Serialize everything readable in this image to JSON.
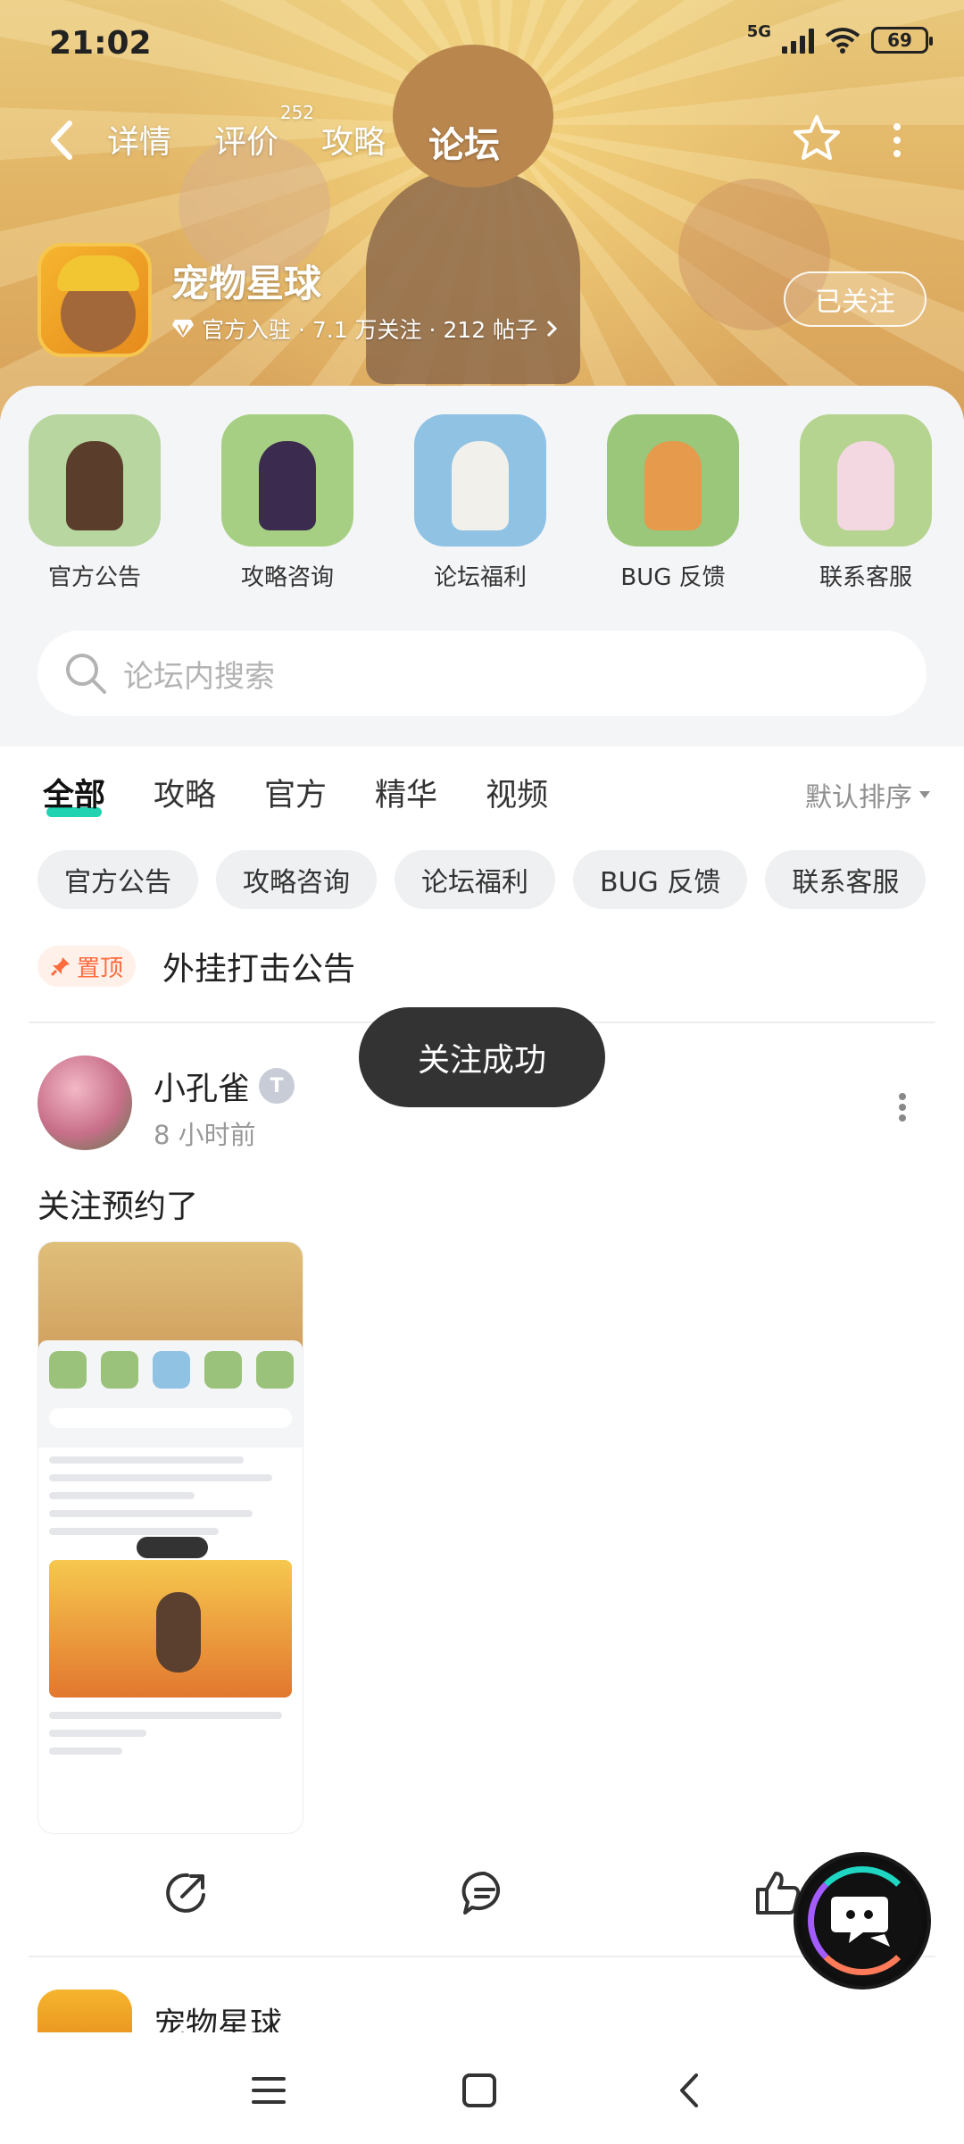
{
  "status_bar": {
    "time": "21:02",
    "network": "5G",
    "battery": "69"
  },
  "top_nav": {
    "tabs": [
      {
        "label": "详情",
        "active": false
      },
      {
        "label": "评价",
        "active": false,
        "badge": "252"
      },
      {
        "label": "攻略",
        "active": false
      },
      {
        "label": "论坛",
        "active": true
      }
    ],
    "accent_color": "#21d3b0"
  },
  "game": {
    "title": "宠物星球",
    "meta": "官方入驻 · 7.1 万关注 · 212 帖子",
    "follow_label": "已关注"
  },
  "categories": [
    {
      "label": "官方公告",
      "bg": "#b8d6a0",
      "fig": "#5b3d2c"
    },
    {
      "label": "攻略咨询",
      "bg": "#a6cf83",
      "fig": "#3b2b4e"
    },
    {
      "label": "论坛福利",
      "bg": "#8fc2e3",
      "fig": "#f2f0ea"
    },
    {
      "label": "BUG 反馈",
      "bg": "#9bc77a",
      "fig": "#e59a4c"
    },
    {
      "label": "联系客服",
      "bg": "#b4d48f",
      "fig": "#f3d8e2"
    }
  ],
  "search": {
    "placeholder": "论坛内搜索"
  },
  "filter_tabs": [
    {
      "label": "全部",
      "active": true
    },
    {
      "label": "攻略",
      "active": false
    },
    {
      "label": "官方",
      "active": false
    },
    {
      "label": "精华",
      "active": false
    },
    {
      "label": "视频",
      "active": false
    }
  ],
  "sort_label": "默认排序",
  "chips": [
    "官方公告",
    "攻略咨询",
    "论坛福利",
    "BUG 反馈",
    "联系客服"
  ],
  "pinned": {
    "badge": "置顶",
    "title": "外挂打击公告"
  },
  "post": {
    "author": "小孔雀",
    "level": "T",
    "time": "8 小时前",
    "text": "关注预约了"
  },
  "toast": "关注成功",
  "next_post": {
    "author": "宠物星球"
  },
  "icons": {
    "back": "chevron-left-icon",
    "favorite": "star-icon",
    "more": "more-vertical-icon",
    "verified": "diamond-icon",
    "search": "search-icon",
    "pin": "pin-icon",
    "share": "share-icon",
    "comment": "comment-icon",
    "like": "thumbs-up-icon",
    "assistant": "chat-assistant-icon"
  }
}
